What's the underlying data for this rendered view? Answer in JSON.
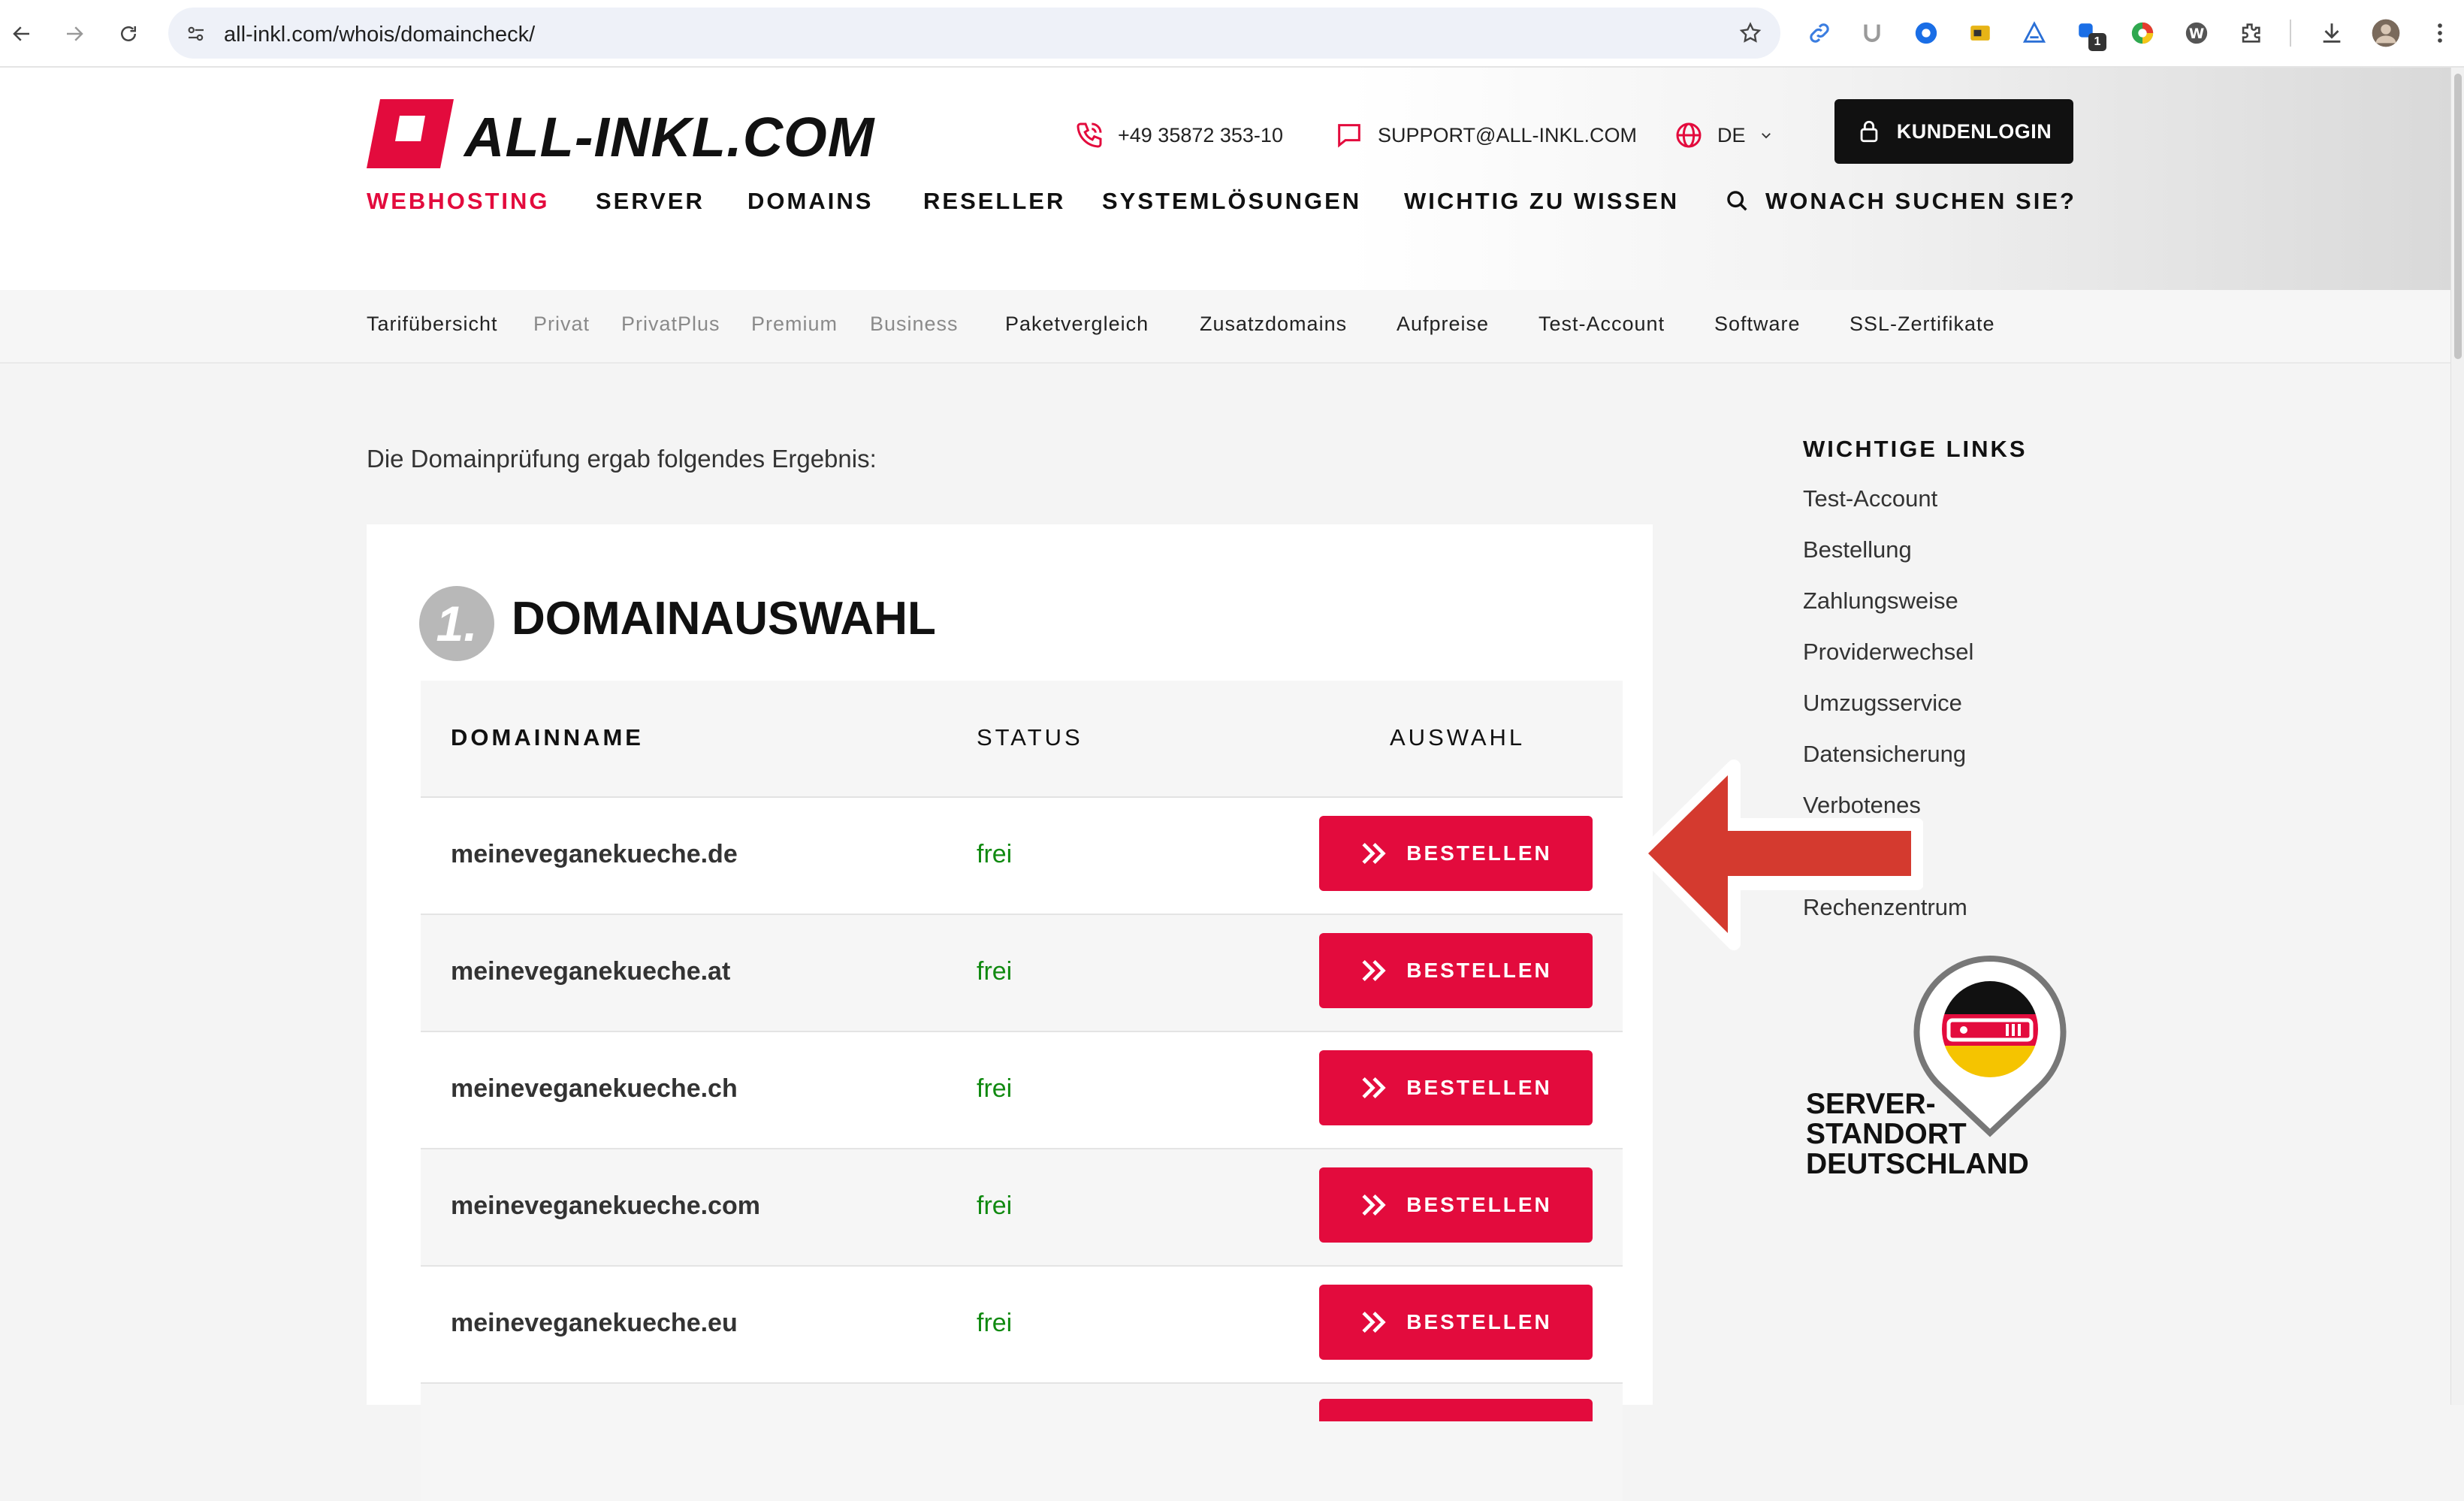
{
  "browser": {
    "url": "all-inkl.com/whois/domaincheck/",
    "extension_badge": "1"
  },
  "header": {
    "logo_text": "ALL-INKL.COM",
    "phone": "+49 35872 353-10",
    "email": "SUPPORT@ALL-INKL.COM",
    "language": "DE",
    "login_label": "KUNDENLOGIN",
    "search_label": "WONACH SUCHEN SIE?",
    "nav": [
      {
        "label": "WEBHOSTING"
      },
      {
        "label": "SERVER"
      },
      {
        "label": "DOMAINS"
      },
      {
        "label": "RESELLER"
      },
      {
        "label": "SYSTEMLÖSUNGEN"
      },
      {
        "label": "WICHTIG ZU WISSEN"
      }
    ]
  },
  "subnav": [
    {
      "label": "Tarifübersicht"
    },
    {
      "label": "Privat"
    },
    {
      "label": "PrivatPlus"
    },
    {
      "label": "Premium"
    },
    {
      "label": "Business"
    },
    {
      "label": "Paketvergleich"
    },
    {
      "label": "Zusatzdomains"
    },
    {
      "label": "Aufpreise"
    },
    {
      "label": "Test-Account"
    },
    {
      "label": "Software"
    },
    {
      "label": "SSL-Zertifikate"
    }
  ],
  "content": {
    "intro": "Die Domainprüfung ergab folgendes Ergebnis:",
    "step_number": "1.",
    "card_title": "DOMAINAUSWAHL",
    "table": {
      "headers": {
        "domain": "DOMAINNAME",
        "status": "STATUS",
        "select": "AUSWAHL"
      },
      "rows": [
        {
          "domain": "meineveganekueche.de",
          "status": "frei",
          "action": "BESTELLEN"
        },
        {
          "domain": "meineveganekueche.at",
          "status": "frei",
          "action": "BESTELLEN"
        },
        {
          "domain": "meineveganekueche.ch",
          "status": "frei",
          "action": "BESTELLEN"
        },
        {
          "domain": "meineveganekueche.com",
          "status": "frei",
          "action": "BESTELLEN"
        },
        {
          "domain": "meineveganekueche.eu",
          "status": "frei",
          "action": "BESTELLEN"
        }
      ]
    }
  },
  "sidebar": {
    "title": "WICHTIGE LINKS",
    "links": [
      {
        "label": "Test-Account"
      },
      {
        "label": "Bestellung"
      },
      {
        "label": "Zahlungsweise"
      },
      {
        "label": "Providerwechsel"
      },
      {
        "label": "Umzugsservice"
      },
      {
        "label": "Datensicherung"
      },
      {
        "label": "Verbotenes"
      },
      {
        "label": ""
      },
      {
        "label": "Rechenzentrum"
      }
    ],
    "standort_lines": [
      "SERVER-",
      "STANDORT",
      "DEUTSCHLAND"
    ]
  },
  "colors": {
    "brand_red": "#e30b3d",
    "status_green": "#118a11",
    "annotation_arrow": "#d43a2f"
  }
}
